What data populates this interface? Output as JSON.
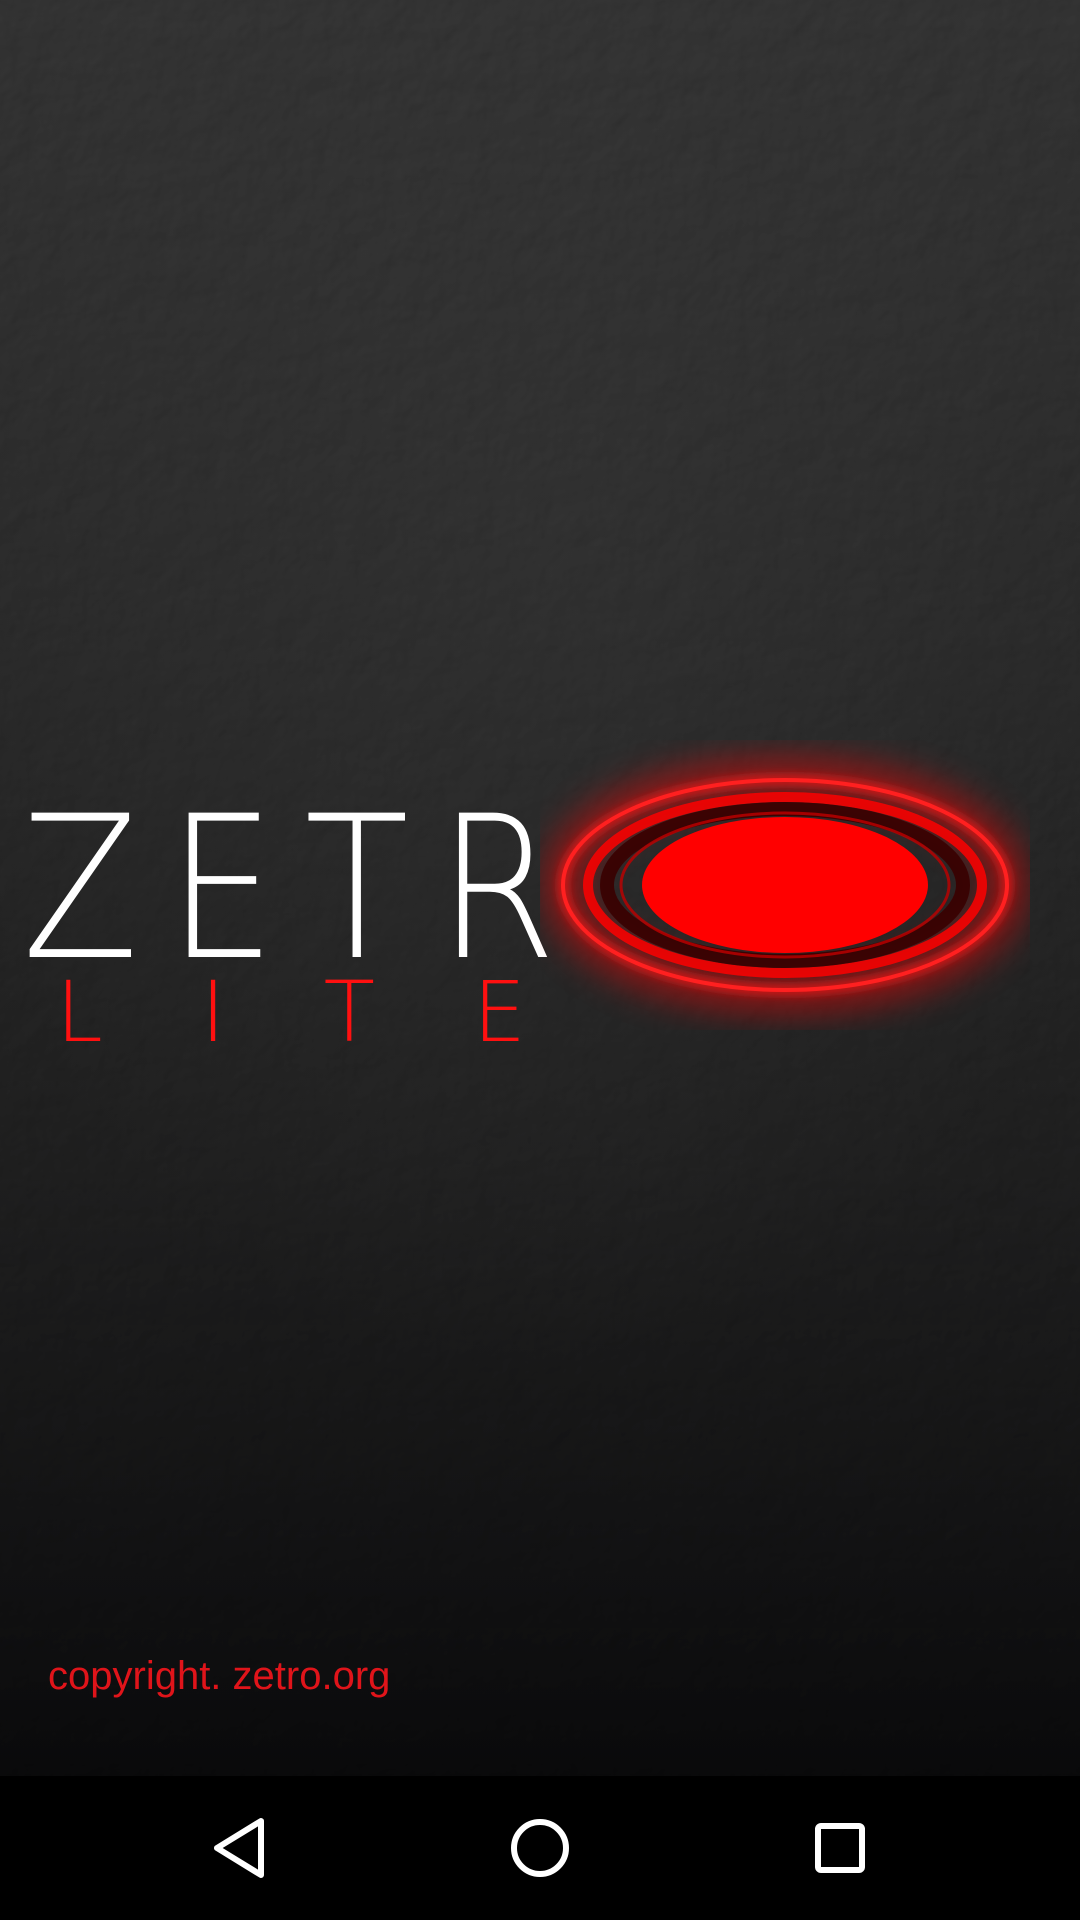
{
  "app": {
    "name_word": "ZETR",
    "name_full": "ZETRO",
    "edition": "LITE",
    "copyright": "copyright. zetro.org"
  },
  "colors": {
    "accent_red": "#ff0000",
    "copyright_red": "#e0141a",
    "title_white": "#ffffff",
    "background_top": "#2a2a2a",
    "background_bottom": "#060607",
    "nav_bar": "#000000"
  },
  "icons": {
    "logo_o": "glowing-red-ring-icon",
    "nav_back": "back-triangle-icon",
    "nav_home": "home-circle-icon",
    "nav_recents": "recents-square-icon"
  }
}
